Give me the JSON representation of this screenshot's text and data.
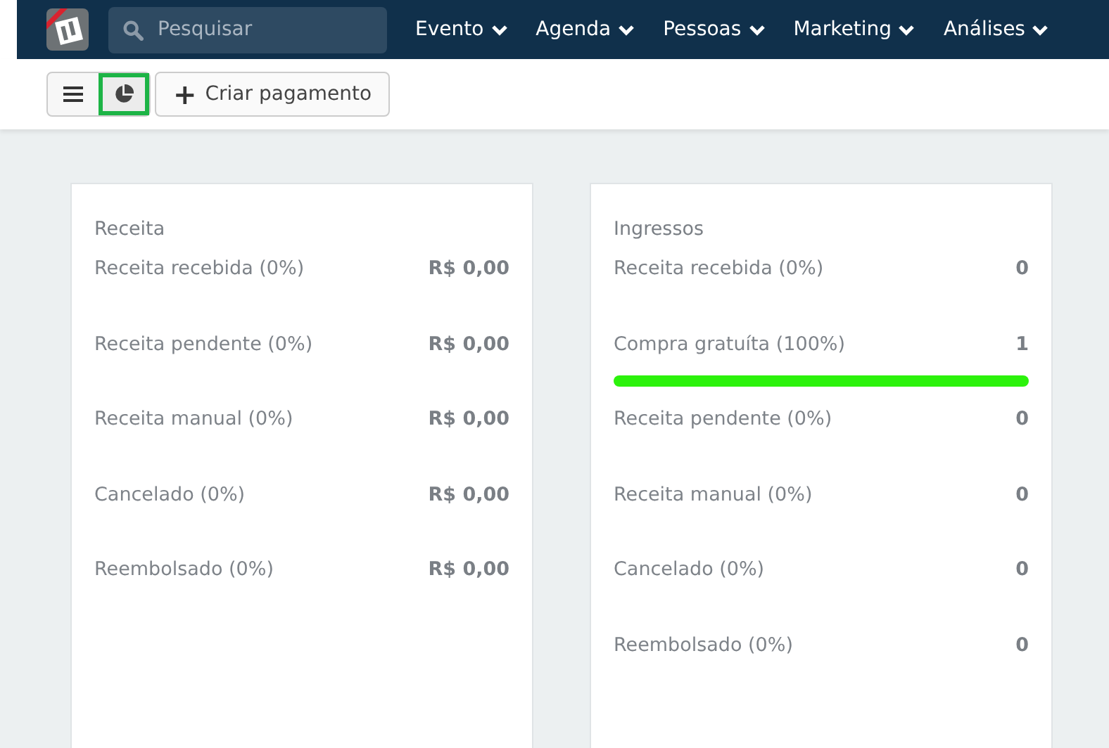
{
  "search": {
    "placeholder": "Pesquisar"
  },
  "nav": [
    {
      "label": "Evento"
    },
    {
      "label": "Agenda"
    },
    {
      "label": "Pessoas"
    },
    {
      "label": "Marketing"
    },
    {
      "label": "Análises"
    }
  ],
  "view_toggles": [
    {
      "kind": "list",
      "selected": false
    },
    {
      "kind": "chart",
      "selected": true
    }
  ],
  "create_button": {
    "icon": "+",
    "label": "Criar pagamento"
  },
  "cards": [
    {
      "title": "Receita",
      "rows": [
        {
          "label": "Receita recebida (0%)",
          "value": "R$ 0,00",
          "highlighted": false
        },
        {
          "label": "Receita pendente (0%)",
          "value": "R$ 0,00",
          "highlighted": false
        },
        {
          "label": "Receita manual (0%)",
          "value": "R$ 0,00",
          "highlighted": false
        },
        {
          "label": "Cancelado (0%)",
          "value": "R$ 0,00",
          "highlighted": false
        },
        {
          "label": "Reembolsado (0%)",
          "value": "R$ 0,00",
          "highlighted": false
        }
      ]
    },
    {
      "title": "Ingressos",
      "rows": [
        {
          "label": "Receita recebida (0%)",
          "value": "0",
          "highlighted": false
        },
        {
          "label": "Compra gratuíta (100%)",
          "value": "1",
          "highlighted": true
        },
        {
          "label": "Receita pendente (0%)",
          "value": "0",
          "highlighted": false
        },
        {
          "label": "Receita manual (0%)",
          "value": "0",
          "highlighted": false
        },
        {
          "label": "Cancelado (0%)",
          "value": "0",
          "highlighted": false
        },
        {
          "label": "Reembolsado (0%)",
          "value": "0",
          "highlighted": false
        }
      ]
    }
  ]
}
